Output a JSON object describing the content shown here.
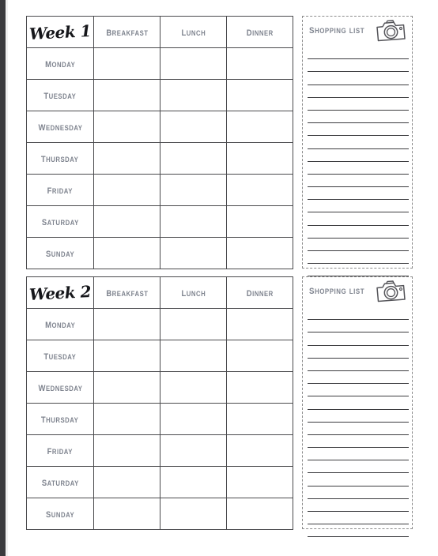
{
  "document": {
    "type": "weekly-meal-planner",
    "page_background": "#ffffff",
    "edge_band_color": "#3a3a3d",
    "ink_color": "#4a4a4d",
    "label_color": "#7e838e",
    "title_color": "#15161a",
    "line_color": "#3c3c3f",
    "dashed_border_color": "#8c8c8c"
  },
  "meal_columns": [
    {
      "key": "day",
      "label": ""
    },
    {
      "key": "breakfast",
      "label": "Breakfast"
    },
    {
      "key": "lunch",
      "label": "Lunch"
    },
    {
      "key": "dinner",
      "label": "Dinner"
    }
  ],
  "days": [
    "Monday",
    "Tuesday",
    "Wednesday",
    "Thursday",
    "Friday",
    "Saturday",
    "Sunday"
  ],
  "blocks": [
    {
      "id": "week-1",
      "week_title": "Week 1",
      "shopping_list": {
        "title": "Shopping List",
        "icon": "camera-icon",
        "line_count": 18,
        "entries": []
      },
      "entries": {
        "Monday": {
          "breakfast": "",
          "lunch": "",
          "dinner": ""
        },
        "Tuesday": {
          "breakfast": "",
          "lunch": "",
          "dinner": ""
        },
        "Wednesday": {
          "breakfast": "",
          "lunch": "",
          "dinner": ""
        },
        "Thursday": {
          "breakfast": "",
          "lunch": "",
          "dinner": ""
        },
        "Friday": {
          "breakfast": "",
          "lunch": "",
          "dinner": ""
        },
        "Saturday": {
          "breakfast": "",
          "lunch": "",
          "dinner": ""
        },
        "Sunday": {
          "breakfast": "",
          "lunch": "",
          "dinner": ""
        }
      }
    },
    {
      "id": "week-2",
      "week_title": "Week 2",
      "shopping_list": {
        "title": "Shopping List",
        "icon": "camera-icon",
        "line_count": 18,
        "entries": []
      },
      "entries": {
        "Monday": {
          "breakfast": "",
          "lunch": "",
          "dinner": ""
        },
        "Tuesday": {
          "breakfast": "",
          "lunch": "",
          "dinner": ""
        },
        "Wednesday": {
          "breakfast": "",
          "lunch": "",
          "dinner": ""
        },
        "Thursday": {
          "breakfast": "",
          "lunch": "",
          "dinner": ""
        },
        "Friday": {
          "breakfast": "",
          "lunch": "",
          "dinner": ""
        },
        "Saturday": {
          "breakfast": "",
          "lunch": "",
          "dinner": ""
        },
        "Sunday": {
          "breakfast": "",
          "lunch": "",
          "dinner": ""
        }
      }
    }
  ]
}
